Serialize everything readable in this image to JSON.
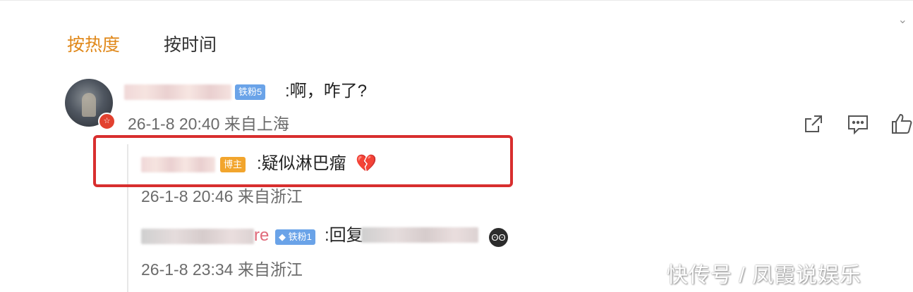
{
  "sort_tabs": [
    {
      "label": "按热度",
      "active": true
    },
    {
      "label": "按时间",
      "active": false
    }
  ],
  "comment": {
    "badge": "铁粉5",
    "text": ":啊，咋了?",
    "meta": "26-1-8 20:40 来自上海",
    "avatar_badge_icon": "verified-icon"
  },
  "actions": {
    "share_icon": "share-icon",
    "comment_icon": "comment-icon",
    "like_icon": "like-icon"
  },
  "replies": [
    {
      "badge": "博主",
      "text": ":疑似淋巴瘤",
      "emoji": "💔",
      "meta": "26-1-8 20:46 来自浙江"
    },
    {
      "name_tail": "re",
      "badge": "铁粉1",
      "text": ":回复",
      "meta": "26-1-8 23:34 来自浙江"
    }
  ],
  "watermark": "快传号 / 凤霞说娱乐",
  "colors": {
    "tab_active": "#e0881a",
    "highlight_border": "#d82e2e",
    "badge_blue": "#6aa3e8",
    "badge_orange": "#f2a52d"
  }
}
